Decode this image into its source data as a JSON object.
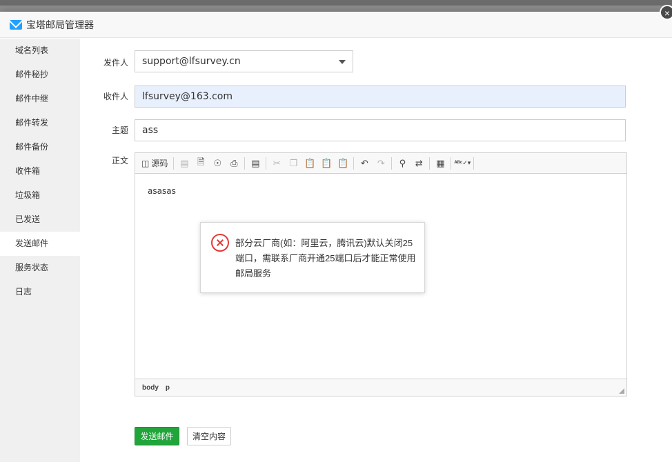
{
  "dialog": {
    "title": "宝塔邮局管理器",
    "close_label": "×"
  },
  "sidebar": {
    "items": [
      {
        "label": "域名列表"
      },
      {
        "label": "邮件秘抄"
      },
      {
        "label": "邮件中继"
      },
      {
        "label": "邮件转发"
      },
      {
        "label": "邮件备份"
      },
      {
        "label": "收件箱"
      },
      {
        "label": "垃圾箱"
      },
      {
        "label": "已发送"
      },
      {
        "label": "发送邮件"
      },
      {
        "label": "服务状态"
      },
      {
        "label": "日志"
      }
    ],
    "active_index": 8
  },
  "form": {
    "sender_label": "发件人",
    "sender_value": "support@lfsurvey.cn",
    "recipient_label": "收件人",
    "recipient_value": "lfsurvey@163.com",
    "subject_label": "主题",
    "subject_value": "ass",
    "body_label": "正文"
  },
  "editor": {
    "source_label": "源码",
    "content": "asasas",
    "status_path": [
      "body",
      "p"
    ]
  },
  "buttons": {
    "send_label": "发送邮件",
    "clear_label": "清空内容"
  },
  "message": {
    "text": "部分云厂商(如：阿里云，腾讯云)默认关闭25端口，需联系厂商开通25端口后才能正常使用邮局服务"
  },
  "colors": {
    "primary_green": "#20a53a",
    "error_red": "#e53935",
    "autofill_blue": "#e8f0fe"
  }
}
